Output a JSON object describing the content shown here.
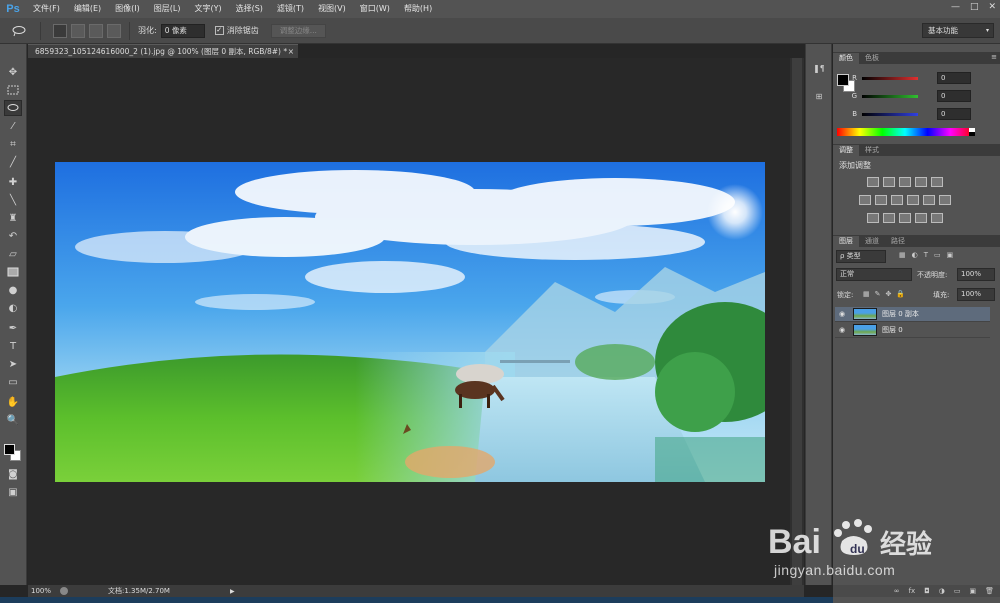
{
  "app": {
    "logo": "Ps",
    "menus": [
      "文件(F)",
      "编辑(E)",
      "图像(I)",
      "图层(L)",
      "文字(Y)",
      "选择(S)",
      "滤镜(T)",
      "视图(V)",
      "窗口(W)",
      "帮助(H)"
    ],
    "window_controls": [
      "—",
      "□",
      "✕"
    ]
  },
  "options": {
    "feather_label": "羽化:",
    "feather_value": "0 像素",
    "antialias_label": "消除锯齿",
    "antialias_checked": "✓",
    "refine_edge": "调整边缘...",
    "workspace": "基本功能"
  },
  "document": {
    "tab_title": "6859323_105124616000_2 (1).jpg @ 100% (图层 0 副本, RGB/8#) *",
    "close": "×",
    "zoom": "100%",
    "doc_size": "文档:1.35M/2.70M"
  },
  "color_panel": {
    "tabs": [
      "颜色",
      "色板"
    ],
    "menu": "≡",
    "channels": [
      {
        "label": "R",
        "value": "0",
        "color": "#e03030"
      },
      {
        "label": "G",
        "value": "0",
        "color": "#30c030"
      },
      {
        "label": "B",
        "value": "0",
        "color": "#3040e0"
      }
    ]
  },
  "adjustments_panel": {
    "tabs": [
      "调整",
      "样式"
    ],
    "title": "添加调整"
  },
  "layers_panel": {
    "tabs": [
      "图层",
      "通道",
      "路径"
    ],
    "filter_kind": "ρ 类型",
    "blend_mode": "正常",
    "opacity_label": "不透明度:",
    "opacity_value": "100%",
    "lock_label": "锁定:",
    "fill_label": "填充:",
    "fill_value": "100%",
    "layers": [
      {
        "name": "图层 0 副本",
        "selected": true
      },
      {
        "name": "图层 0",
        "selected": false
      }
    ]
  },
  "watermark": {
    "text": "Bai 经验",
    "url": "jingyan.baidu.com"
  }
}
